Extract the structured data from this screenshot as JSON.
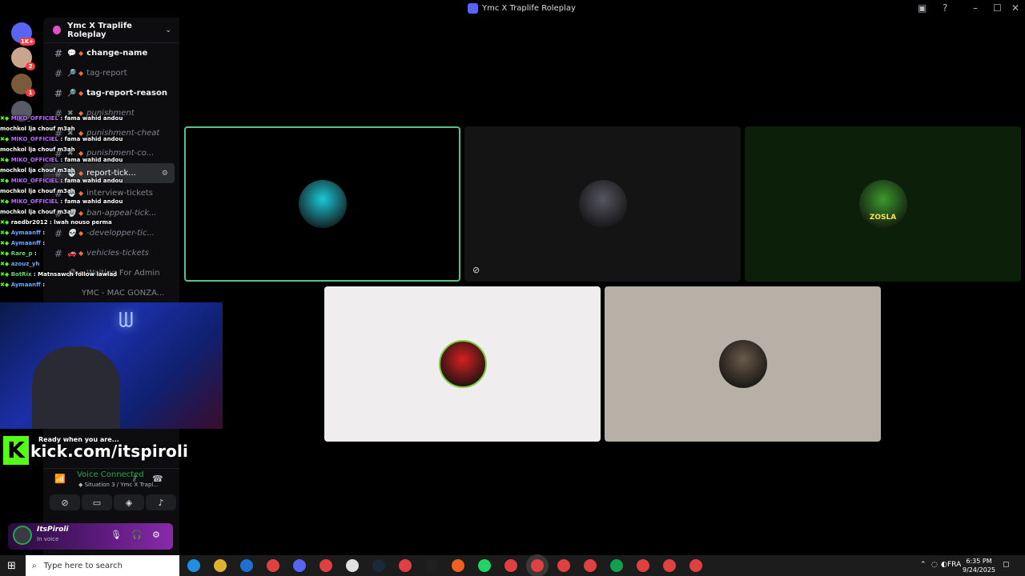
{
  "window": {
    "title": "Ymc X Traplife Roleplay",
    "controls": {
      "inbox": "inbox-icon",
      "help": "help-icon",
      "minimize": "–",
      "maximize": "☐",
      "close": "✕"
    }
  },
  "guilds": [
    {
      "badge": "1K+",
      "kind": "home",
      "color": "#5865f2"
    },
    {
      "badge": "2",
      "color": "#c9a58f"
    },
    {
      "badge": "1",
      "color": "#7a5a3a"
    },
    {
      "badge": "",
      "color": "#5a5a66"
    }
  ],
  "server": {
    "name": "Ymc X Traplife Roleplay",
    "chevron": "⌄"
  },
  "channels": [
    {
      "name": "change-name",
      "emoji": "💬",
      "style": "bold"
    },
    {
      "name": "tag-report",
      "emoji": "🔎",
      "style": "muted"
    },
    {
      "name": "tag-report-reason",
      "emoji": "🔎",
      "style": "bold"
    },
    {
      "name": "punishment",
      "emoji": "✖",
      "style": "italic"
    },
    {
      "name": "punishment-cheat",
      "emoji": "✖",
      "style": "italic"
    },
    {
      "name": "punishment-co...",
      "emoji": "✖",
      "style": "italic"
    },
    {
      "name": "report-tick...",
      "emoji": "💀",
      "style": "active"
    },
    {
      "name": "interview-tickets",
      "emoji": "💀",
      "style": "muted"
    },
    {
      "name": "ban-appeal-tick...",
      "emoji": "💀",
      "style": "italic"
    },
    {
      "name": "-developper-tic...",
      "emoji": "💀",
      "style": "italic"
    },
    {
      "name": "vehicles-tickets",
      "emoji": "🚗",
      "style": "italic"
    },
    {
      "name": "Waiting For Admin",
      "emoji": "🔊",
      "style": "voice"
    },
    {
      "name": "YMC - MAC GONZA...",
      "emoji": "",
      "style": "voice-muted"
    }
  ],
  "chat": [
    {
      "user": "MIKO_OFFICIEL",
      "msg": ": fama wahid andou",
      "cont": "mochkol lja chouf m3ah",
      "color": "p"
    },
    {
      "user": "MIKO_OFFICIEL",
      "msg": ": fama wahid andou",
      "cont": "mochkol lja chouf m3ah",
      "color": "p"
    },
    {
      "user": "MIKO_OFFICIEL",
      "msg": ": fama wahid andou",
      "cont": "mochkol lja chouf m3ah",
      "color": "p"
    },
    {
      "user": "MIKO_OFFICIEL",
      "msg": ": fama wahid andou",
      "cont": "mochkol lja chouf m3ah",
      "color": "p"
    },
    {
      "user": "MIKO_OFFICIEL",
      "msg": ": fama wahid andou",
      "cont": "mochkol lja chouf m3ah",
      "color": "p"
    },
    {
      "user": "raedbr2012",
      "msg": ": lwah nouso perma",
      "cont": "",
      "color": "w"
    },
    {
      "user": "Aymaanff",
      "msg": ":",
      "cont": "",
      "color": "b"
    },
    {
      "user": "Aymaanff",
      "msg": ":",
      "cont": "",
      "color": "b"
    },
    {
      "user": "Rare_p",
      "msg": ":",
      "cont": "",
      "color": "g"
    },
    {
      "user": "azouz_yh",
      "msg": "",
      "cont": "",
      "color": "b"
    },
    {
      "user": "BotRix",
      "msg": ": Matnsawch follow lawlad",
      "cont": "",
      "color": "g"
    },
    {
      "user": "Aymaanff",
      "msg": ":",
      "cont": "",
      "color": "b"
    }
  ],
  "overlay": {
    "ready": "Ready when you are...",
    "kick_letter": "K",
    "kick_url": "kick.com/itspiroli"
  },
  "voice": {
    "status": "Voice Connected",
    "channel": "◆ Situation 3 / Ymc X Trapl...",
    "buttons": [
      "camera-off-icon",
      "screen-share-icon",
      "activity-icon",
      "soundboard-icon"
    ]
  },
  "user": {
    "name": "ItsPiroli",
    "status": "In voice"
  },
  "tiles": [
    {
      "name": "tile-1",
      "bg": "#000000",
      "avatar": "#1cc8d8",
      "speaking": true,
      "muted": false
    },
    {
      "name": "tile-2",
      "bg": "#141414",
      "avatar": "#555560",
      "speaking": false,
      "muted": true
    },
    {
      "name": "tile-3",
      "bg": "#0c1f08",
      "avatar": "#3a9a2a",
      "speaking": false,
      "muted": false,
      "label": "ZOSLA"
    },
    {
      "name": "tile-4",
      "bg": "#efeded",
      "avatar": "#d62020",
      "speaking": false,
      "muted": false
    },
    {
      "name": "tile-5",
      "bg": "#b6b0a6",
      "avatar": "#6a5a4a",
      "speaking": false,
      "muted": false
    }
  ],
  "taskbar": {
    "search_placeholder": "Type here to search",
    "language": "FRA",
    "time": "6:35 PM",
    "date": "9/24/2025",
    "apps": [
      "#1f8fe0",
      "#e0b030",
      "#1f6fd0",
      "#e04040",
      "#5865f2",
      "#e04040",
      "#e0e0e0",
      "#1b2838",
      "#e04040",
      "#202020",
      "#f06020",
      "#1ed760",
      "#e04040",
      "#e04040",
      "#e04040",
      "#e04040",
      "#10a050",
      "#e04040",
      "#e04040",
      "#e04040"
    ]
  }
}
